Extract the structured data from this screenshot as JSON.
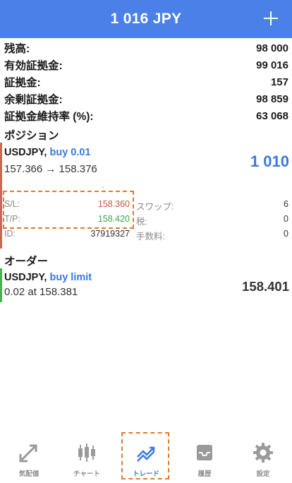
{
  "header": {
    "title": "1 016 JPY"
  },
  "summary": [
    {
      "label": "残高:",
      "value": "98 000"
    },
    {
      "label": "有効証拠金:",
      "value": "99 016"
    },
    {
      "label": "証拠金:",
      "value": "157"
    },
    {
      "label": "余剰証拠金:",
      "value": "98 859"
    },
    {
      "label": "証拠金維持率 (%):",
      "value": "63 068"
    }
  ],
  "positions": {
    "title": "ポジション",
    "item": {
      "symbol": "USDJPY,",
      "direction": "buy 0.01",
      "prices": "157.366 → 158.376",
      "profit": "1 010",
      "sl_label": "S/L:",
      "sl_value": "158.360",
      "tp_label": "T/P:",
      "tp_value": "158.420",
      "id_label": "ID:",
      "id_value": "37919327",
      "swap_label": "スワップ:",
      "swap_value": "6",
      "tax_label": "税:",
      "tax_value": "0",
      "fee_label": "手数料:",
      "fee_value": "0"
    }
  },
  "orders": {
    "title": "オーダー",
    "item": {
      "symbol": "USDJPY,",
      "direction": "buy limit",
      "line2": "0.02 at 158.381",
      "price": "158.401"
    }
  },
  "tabbar": {
    "active": "trade",
    "tabs": [
      {
        "id": "quotes",
        "label": "気配値",
        "icon": "quotes-arrows-icon"
      },
      {
        "id": "chart",
        "label": "チャート",
        "icon": "candlestick-icon"
      },
      {
        "id": "trade",
        "label": "トレード",
        "icon": "trend-chart-icon"
      },
      {
        "id": "history",
        "label": "履歴",
        "icon": "inbox-tray-icon"
      },
      {
        "id": "settings",
        "label": "設定",
        "icon": "gear-icon"
      }
    ]
  },
  "colors": {
    "accent": "#4a80e8",
    "loss": "#cc5544",
    "profit_tp": "#3aa84c",
    "highlight": "#e07a2c"
  }
}
